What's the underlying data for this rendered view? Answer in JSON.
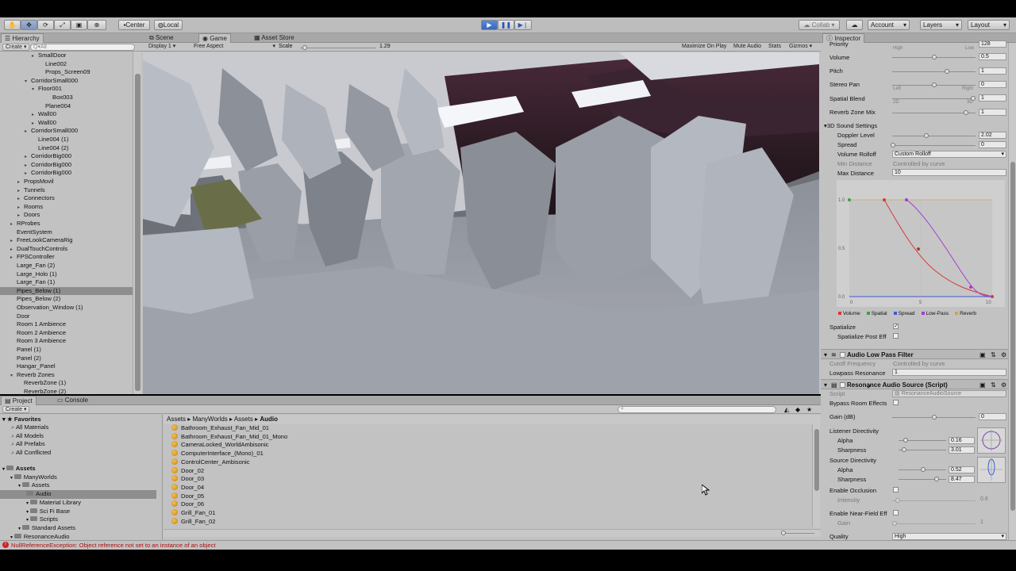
{
  "toolbar": {
    "center": "Center",
    "local": "Local",
    "collab": "Collab ▾",
    "account": "Account",
    "layers": "Layers",
    "layout": "Layout"
  },
  "hierarchy": {
    "tab": "Hierarchy",
    "create": "Create ▾",
    "search": "Q▾All",
    "rows": [
      {
        "label": "SmallDoor",
        "indent": 4,
        "arrow": "▸",
        "sel": false
      },
      {
        "label": "Line002",
        "indent": 5,
        "arrow": "",
        "sel": false
      },
      {
        "label": "Props_Screen09",
        "indent": 5,
        "arrow": "",
        "sel": false
      },
      {
        "label": "CorridorSmall000",
        "indent": 3,
        "arrow": "▾",
        "sel": false
      },
      {
        "label": "Floor001",
        "indent": 4,
        "arrow": "▾",
        "sel": false
      },
      {
        "label": "Box003",
        "indent": 6,
        "arrow": "",
        "sel": false
      },
      {
        "label": "Plane004",
        "indent": 5,
        "arrow": "",
        "sel": false
      },
      {
        "label": "Wall00",
        "indent": 4,
        "arrow": "▸",
        "sel": false
      },
      {
        "label": "Wall00",
        "indent": 4,
        "arrow": "▸",
        "sel": false
      },
      {
        "label": "CorridorSmall000",
        "indent": 3,
        "arrow": "▸",
        "sel": false
      },
      {
        "label": "Line004 (1)",
        "indent": 4,
        "arrow": "",
        "sel": false
      },
      {
        "label": "Line004 (2)",
        "indent": 4,
        "arrow": "",
        "sel": false
      },
      {
        "label": "CorridorBig000",
        "indent": 3,
        "arrow": "▸",
        "sel": false
      },
      {
        "label": "CorridorBig000",
        "indent": 3,
        "arrow": "▸",
        "sel": false
      },
      {
        "label": "CorridorBig000",
        "indent": 3,
        "arrow": "▸",
        "sel": false
      },
      {
        "label": "PropsMovil",
        "indent": 2,
        "arrow": "▸",
        "sel": false
      },
      {
        "label": "Tunnels",
        "indent": 2,
        "arrow": "▸",
        "sel": false
      },
      {
        "label": "Connectors",
        "indent": 2,
        "arrow": "▸",
        "sel": false
      },
      {
        "label": "Rooms",
        "indent": 2,
        "arrow": "▸",
        "sel": false
      },
      {
        "label": "Doors",
        "indent": 2,
        "arrow": "▸",
        "sel": false
      },
      {
        "label": "RProbes",
        "indent": 1,
        "arrow": "▸",
        "sel": false
      },
      {
        "label": "EventSystem",
        "indent": 1,
        "arrow": "",
        "sel": false
      },
      {
        "label": "FreeLookCameraRig",
        "indent": 1,
        "arrow": "▸",
        "sel": false
      },
      {
        "label": "DualTouchControls",
        "indent": 1,
        "arrow": "▸",
        "sel": false
      },
      {
        "label": "FPSController",
        "indent": 1,
        "arrow": "▸",
        "sel": false
      },
      {
        "label": "Large_Fan (2)",
        "indent": 1,
        "arrow": "",
        "sel": false
      },
      {
        "label": "Large_Holo (1)",
        "indent": 1,
        "arrow": "",
        "sel": false
      },
      {
        "label": "Large_Fan (1)",
        "indent": 1,
        "arrow": "",
        "sel": false
      },
      {
        "label": "Pipes_Below (1)",
        "indent": 1,
        "arrow": "",
        "sel": true
      },
      {
        "label": "Pipes_Below (2)",
        "indent": 1,
        "arrow": "",
        "sel": false
      },
      {
        "label": "Observation_Window (1)",
        "indent": 1,
        "arrow": "",
        "sel": false
      },
      {
        "label": "Door",
        "indent": 1,
        "arrow": "",
        "sel": false
      },
      {
        "label": "Room 1 Ambience",
        "indent": 1,
        "arrow": "",
        "sel": false
      },
      {
        "label": "Room 2 Ambience",
        "indent": 1,
        "arrow": "",
        "sel": false
      },
      {
        "label": "Room 3 Ambience",
        "indent": 1,
        "arrow": "",
        "sel": false
      },
      {
        "label": "Panel (1)",
        "indent": 1,
        "arrow": "",
        "sel": false
      },
      {
        "label": "Panel (2)",
        "indent": 1,
        "arrow": "",
        "sel": false
      },
      {
        "label": "Hangar_Panel",
        "indent": 1,
        "arrow": "",
        "sel": false
      },
      {
        "label": "Reverb Zones",
        "indent": 1,
        "arrow": "▾",
        "sel": false
      },
      {
        "label": "ReverbZone (1)",
        "indent": 2,
        "arrow": "",
        "sel": false
      },
      {
        "label": "ReverbZone (2)",
        "indent": 2,
        "arrow": "",
        "sel": false
      }
    ]
  },
  "game": {
    "tabs": [
      "Scene",
      "Game",
      "Asset Store"
    ],
    "display": "Display 1",
    "aspect": "Free Aspect",
    "scale_label": "Scale",
    "scale_value": "1.29",
    "scale_fraction": 0.06,
    "buttons": [
      "Maximize On Play",
      "Mute Audio",
      "Stats",
      "Gizmos ▾"
    ]
  },
  "inspector": {
    "tab": "Inspector",
    "priority": {
      "label": "Priority",
      "value": "128",
      "left": "High",
      "right": "Low"
    },
    "volume": {
      "label": "Volume",
      "value": "0.5"
    },
    "pitch": {
      "label": "Pitch",
      "value": "1"
    },
    "stereo_pan": {
      "label": "Stereo Pan",
      "value": "0",
      "left": "Left",
      "right": "Right"
    },
    "spatial_blend": {
      "label": "Spatial Blend",
      "value": "1",
      "left": "2D",
      "right": "3D"
    },
    "reverb_zone_mix": {
      "label": "Reverb Zone Mix",
      "value": "1"
    },
    "sound3d": "3D Sound Settings",
    "doppler": {
      "label": "Doppler Level",
      "value": "2.02"
    },
    "spread": {
      "label": "Spread",
      "value": "0"
    },
    "rolloff": {
      "label": "Volume Rolloff",
      "value": "Custom Rolloff"
    },
    "min_distance": {
      "label": "Min Distance",
      "value": "Controlled by curve"
    },
    "max_distance": {
      "label": "Max Distance",
      "value": "10"
    },
    "curve_ticks": {
      "y": [
        "1.0",
        "0.5",
        "0.0"
      ],
      "x": [
        "0",
        "5",
        "10"
      ]
    },
    "legend": [
      {
        "label": "Volume",
        "color": "#d43a3a"
      },
      {
        "label": "Spatial",
        "color": "#3aa43a"
      },
      {
        "label": "Spread",
        "color": "#3a5ad4"
      },
      {
        "label": "Low-Pass",
        "color": "#a83ad4"
      },
      {
        "label": "Reverb",
        "color": "#d4a43a"
      }
    ],
    "spatialize": "Spatialize",
    "spatialize_post": "Spatialize Post Eff",
    "lowpass": {
      "title": "Audio Low Pass Filter",
      "cutoff_label": "Cutoff Frequency",
      "cutoff_value": "Controlled by curve",
      "res_label": "Lowpass Resonance",
      "res_value": "1"
    },
    "resonance": {
      "title": "Resonance Audio Source (Script)",
      "script_label": "Script",
      "script_value": "ResonanceAudioSource",
      "bypass": "Bypass Room Effects",
      "gain": {
        "label": "Gain (dB)",
        "value": "0"
      },
      "listener": "Listener Directivity",
      "l_alpha": {
        "label": "Alpha",
        "value": "0.16"
      },
      "l_sharp": {
        "label": "Sharpness",
        "value": "3.01"
      },
      "source": "Source Directivity",
      "s_alpha": {
        "label": "Alpha",
        "value": "0.52"
      },
      "s_sharp": {
        "label": "Sharpness",
        "value": "8.47"
      },
      "occlusion": "Enable Occlusion",
      "intensity": {
        "label": "Intensity",
        "value": "0.6"
      },
      "nearfield": "Enable Near-Field Eff",
      "nf_gain": {
        "label": "Gain",
        "value": "1"
      },
      "quality": {
        "label": "Quality",
        "value": "High"
      }
    }
  },
  "project": {
    "tabs": [
      "Project",
      "Console"
    ],
    "create": "Create ▾",
    "favorites": {
      "title": "Favorites",
      "items": [
        "All Materials",
        "All Models",
        "All Prefabs",
        "All Conflicted"
      ]
    },
    "assets_tree": [
      {
        "label": "Assets",
        "indent": 0,
        "bold": true,
        "sel": false
      },
      {
        "label": "ManyWorlds",
        "indent": 1,
        "bold": false,
        "sel": false
      },
      {
        "label": "Assets",
        "indent": 2,
        "bold": false,
        "sel": false
      },
      {
        "label": "Audio",
        "indent": 3,
        "bold": false,
        "sel": true
      },
      {
        "label": "Material Library",
        "indent": 3,
        "bold": false,
        "sel": false
      },
      {
        "label": "Sci Fi Base",
        "indent": 3,
        "bold": false,
        "sel": false
      },
      {
        "label": "Scripts",
        "indent": 3,
        "bold": false,
        "sel": false
      },
      {
        "label": "Standard Assets",
        "indent": 2,
        "bold": false,
        "sel": false
      },
      {
        "label": "ResonanceAudio",
        "indent": 1,
        "bold": false,
        "sel": false
      }
    ],
    "breadcrumb": [
      "Assets",
      "ManyWorlds",
      "Assets",
      "Audio"
    ],
    "files": [
      "Bathroom_Exhaust_Fan_Mid_01",
      "Bathroom_Exhaust_Fan_Mid_01_Mono",
      "CameraLocked_WorldAmbisonic",
      "ComputerInterface_(Mono)_01",
      "ControlCenter_Ambisonic",
      "Door_02",
      "Door_03",
      "Door_04",
      "Door_05",
      "Door_06",
      "Grill_Fan_01",
      "Grill_Fan_02"
    ]
  },
  "status": {
    "error": "NullReferenceException: Object reference not set to an instance of an object"
  }
}
